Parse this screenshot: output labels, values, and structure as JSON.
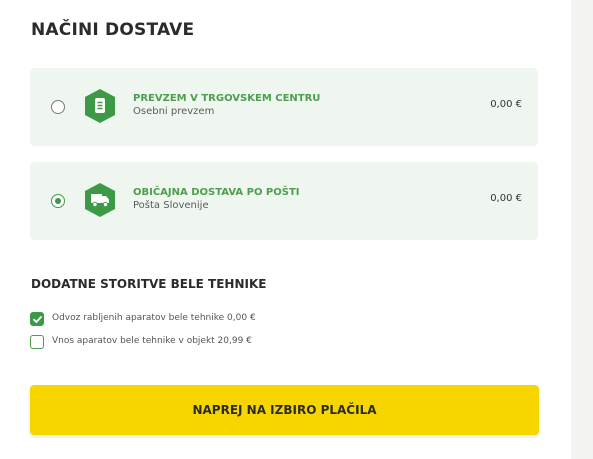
{
  "delivery": {
    "title": "NAČINI DOSTAVE",
    "options": [
      {
        "name": "PREVZEM V TRGOVSKEM CENTRU",
        "subtitle": "Osebni prevzem",
        "price": "0,00 €",
        "selected": false,
        "icon": "store-pickup-icon"
      },
      {
        "name": "OBIČAJNA DOSTAVA PO POŠTI",
        "subtitle": "Pošta Slovenije",
        "price": "0,00 €",
        "selected": true,
        "icon": "delivery-truck-icon"
      }
    ]
  },
  "extras": {
    "title": "DODATNE STORITVE BELE TEHNIKE",
    "items": [
      {
        "label": "Odvoz rabljenih aparatov bele tehnike 0,00 €",
        "checked": true
      },
      {
        "label": "Vnos aparatov bele tehnike v objekt 20,99 €",
        "checked": false
      }
    ]
  },
  "cta": {
    "label": "NAPREJ NA IZBIRO PLAČILA"
  },
  "colors": {
    "accent_green": "#3c9a46",
    "option_bg": "#eef6ef",
    "cta_yellow": "#f7d600"
  }
}
